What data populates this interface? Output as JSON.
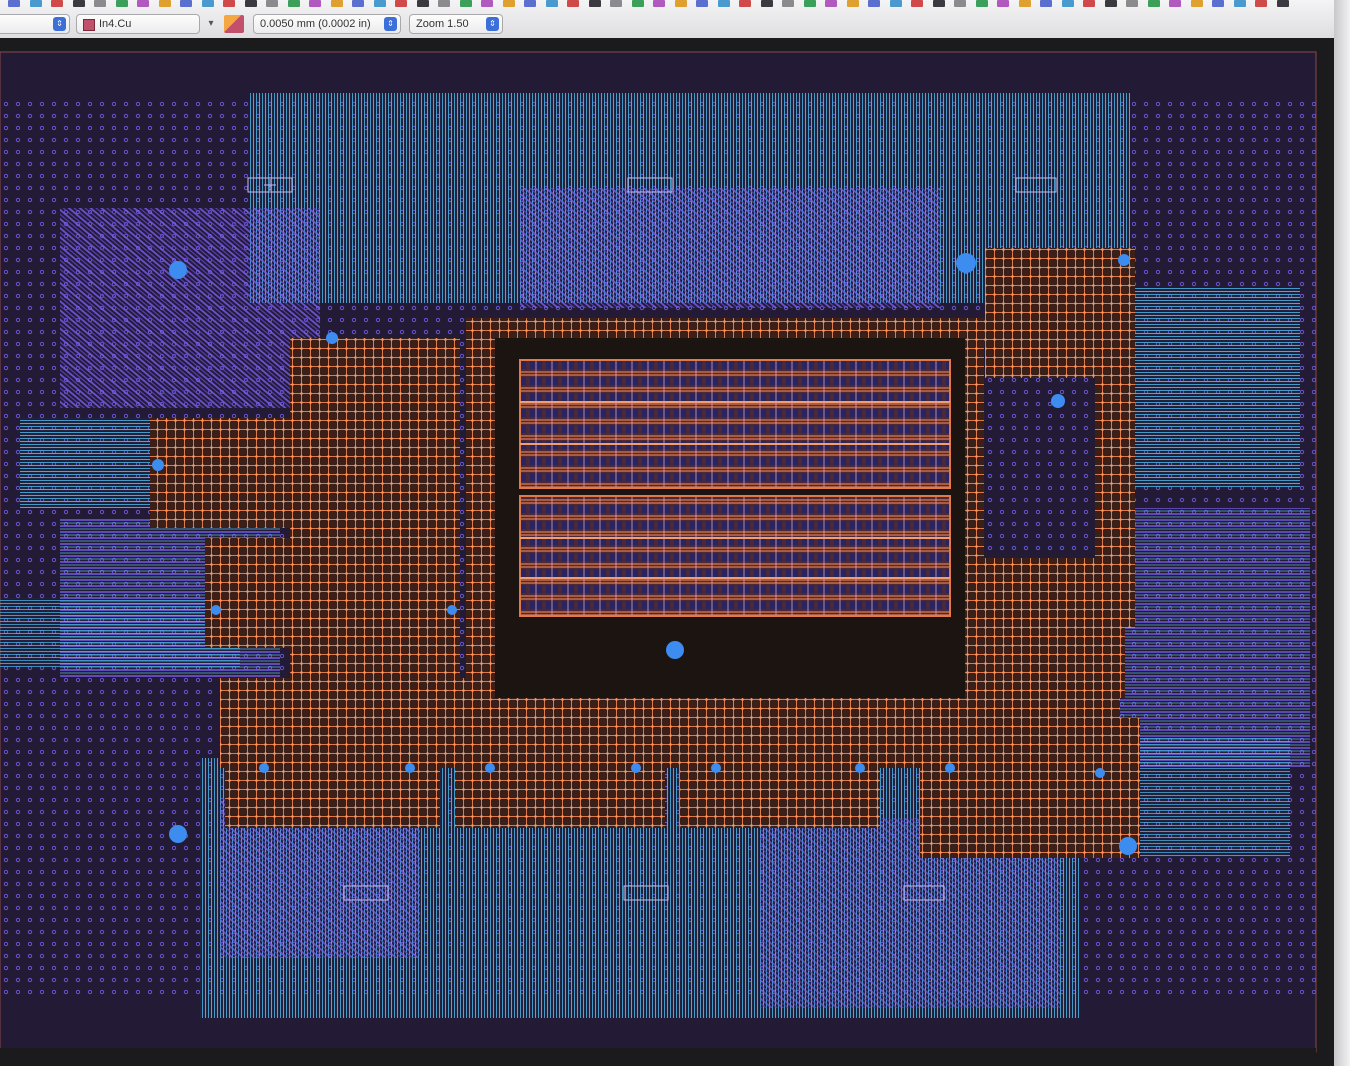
{
  "toolbar": {
    "layer_select": {
      "value": "In4.Cu",
      "swatch_color": "#c2506a"
    },
    "grid_select": {
      "value": "0.0050 mm (0.0002 in)"
    },
    "zoom_select": {
      "value": "Zoom 1.50"
    }
  },
  "canvas": {
    "background_color": "#1b1b1e",
    "board_color": "#231a36",
    "via_grid_color": "#6d5be0",
    "trace_colors": [
      "#3cc7b9",
      "#45a8d6",
      "#7a5ce8",
      "#e07a4a"
    ],
    "mounting_hole_color": "#3d8cf0"
  }
}
